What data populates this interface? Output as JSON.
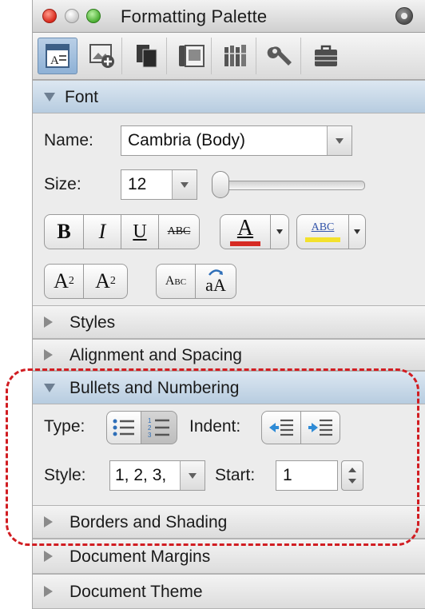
{
  "window": {
    "title": "Formatting Palette"
  },
  "toolbar": {
    "icons": [
      "text-formatting-icon",
      "add-picture-icon",
      "copy-pages-icon",
      "picture-frame-icon",
      "library-icon",
      "wrench-icon",
      "toolbox-icon"
    ],
    "active_index": 0
  },
  "sections": {
    "font": "Font",
    "styles": "Styles",
    "alignment": "Alignment and Spacing",
    "bullets": "Bullets and Numbering",
    "borders": "Borders and Shading",
    "margins": "Document Margins",
    "theme": "Document Theme"
  },
  "font": {
    "name_label": "Name:",
    "name_value": "Cambria (Body)",
    "size_label": "Size:",
    "size_value": "12",
    "bold": "B",
    "italic": "I",
    "underline": "U",
    "strike": "ABC",
    "font_color_letter": "A",
    "highlight_text": "ABC",
    "superscript_base": "A",
    "superscript_exp": "2",
    "subscript_base": "A",
    "subscript_exp": "2",
    "smallcaps": "Abc",
    "change_case_big": "a",
    "change_case_cap": "A",
    "font_color": "#d62a23",
    "highlight_color": "#f3e12c"
  },
  "bullets": {
    "type_label": "Type:",
    "indent_label": "Indent:",
    "style_label": "Style:",
    "style_value": "1, 2, 3,",
    "start_label": "Start:",
    "start_value": "1"
  },
  "colors": {
    "callout": "#d11d22",
    "accent": "#2f6fb8"
  }
}
